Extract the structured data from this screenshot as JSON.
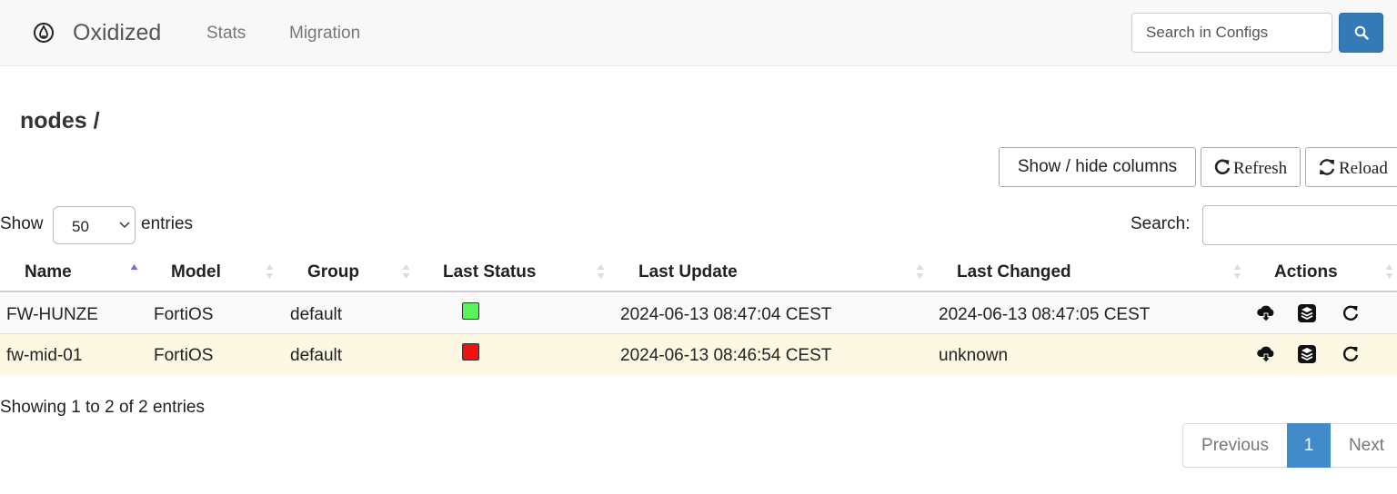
{
  "navbar": {
    "brand": "Oxidized",
    "links": [
      "Stats",
      "Migration"
    ],
    "search_placeholder": "Search in Configs",
    "brand_icon": "oxidized-flame-icon",
    "search_icon": "search-icon"
  },
  "page_title": "nodes /",
  "toolbar": {
    "columns_label": "Show / hide columns",
    "refresh_label": "Refresh",
    "reload_label": "Reload"
  },
  "length_menu": {
    "show": "Show",
    "value": "50",
    "entries": "entries"
  },
  "filter": {
    "label": "Search:",
    "value": ""
  },
  "table": {
    "columns": [
      "Name",
      "Model",
      "Group",
      "Last Status",
      "Last Update",
      "Last Changed",
      "Actions"
    ],
    "sorted_column": "Name",
    "sort_direction": "ascending",
    "rows": [
      {
        "name": "FW-HUNZE",
        "model": "FortiOS",
        "group": "default",
        "status": "success",
        "status_color": "#5cf25c",
        "last_update": "2024-06-13 08:47:04 CEST",
        "last_changed": "2024-06-13 08:47:05 CEST"
      },
      {
        "name": "fw-mid-01",
        "model": "FortiOS",
        "group": "default",
        "status": "no_connection",
        "status_color": "#ee1111",
        "last_update": "2024-06-13 08:46:54 CEST",
        "last_changed": "unknown"
      }
    ],
    "row_actions": [
      "download-config-icon",
      "versions-icon",
      "refresh-node-icon"
    ]
  },
  "info": "Showing 1 to 2 of 2 entries",
  "pagination": {
    "previous": "Previous",
    "current": "1",
    "next": "Next"
  },
  "colors": {
    "primary": "#337ab7",
    "pager_active": "#428bca",
    "highlight_row": "#fcf8e3"
  }
}
